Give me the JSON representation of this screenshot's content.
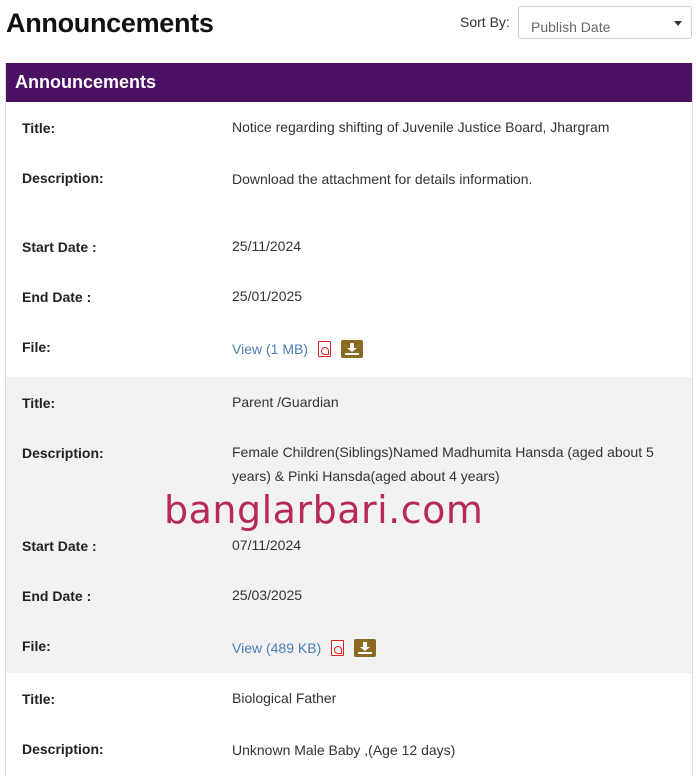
{
  "page": {
    "title": "Announcements"
  },
  "sort": {
    "label": "Sort By:",
    "selected": "Publish Date"
  },
  "panel": {
    "title": "Announcements"
  },
  "labels": {
    "title": "Title:",
    "description": "Description:",
    "start_date": "Start Date :",
    "end_date": "End Date :",
    "file": "File:"
  },
  "announcements": [
    {
      "title": "Notice regarding shifting of Juvenile Justice Board, Jhargram",
      "description": "Download the attachment for details information.",
      "start_date": "25/11/2024",
      "end_date": "25/01/2025",
      "file_link": "View (1 MB)"
    },
    {
      "title": "Parent /Guardian",
      "description": "Female Children(Siblings)Named Madhumita Hansda (aged about 5 years) & Pinki Hansda(aged about 4 years)",
      "start_date": "07/11/2024",
      "end_date": "25/03/2025",
      "file_link": "View (489 KB)"
    },
    {
      "title": "Biological Father",
      "description": "Unknown Male Baby ,(Age 12 days)"
    }
  ],
  "watermark": "banglarbari.com",
  "icons": {
    "pdf": "pdf-icon",
    "download": "download-icon",
    "caret": "chevron-down-icon"
  },
  "colors": {
    "header_bg": "#4b1264",
    "link": "#4a7fb5",
    "download_btn": "#8a6a20",
    "alt_row": "#f2f2f2"
  }
}
